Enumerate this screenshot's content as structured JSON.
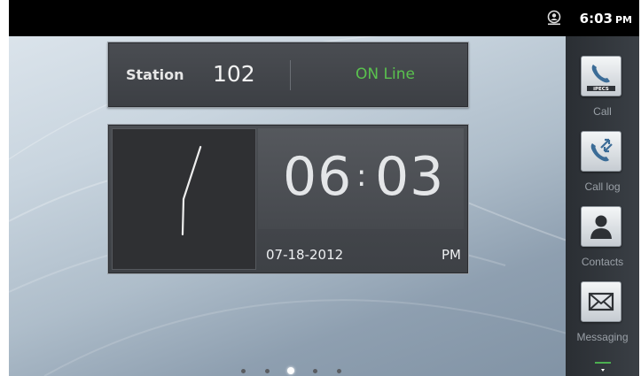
{
  "status_bar": {
    "time": "6:03",
    "ampm": "PM",
    "notification_icon": "globe-user-icon"
  },
  "station": {
    "label": "Station",
    "number": "102",
    "status": "ON Line",
    "status_color": "#5ac24e"
  },
  "clock": {
    "hours": "06",
    "separator": ":",
    "minutes": "03",
    "date": "07-18-2012",
    "ampm": "PM",
    "analog_time": {
      "hour": 6,
      "minute": 3
    }
  },
  "dock": {
    "items": [
      {
        "label": "Call",
        "icon": "phone-icon",
        "badge": "iPECS"
      },
      {
        "label": "Call log",
        "icon": "call-log-icon"
      },
      {
        "label": "Contacts",
        "icon": "contact-person-icon"
      },
      {
        "label": "Messaging",
        "icon": "envelope-icon"
      }
    ],
    "more_icon": "chevron-down-icon"
  },
  "pager": {
    "count": 5,
    "active_index": 2
  }
}
